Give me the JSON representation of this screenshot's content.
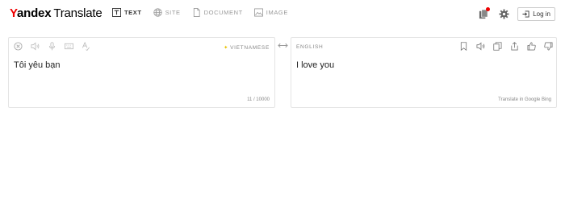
{
  "header": {
    "logo_first": "Y",
    "logo_brand": "andex",
    "logo_rest": "Translate",
    "tabs": [
      {
        "label": "TEXT",
        "active": true
      },
      {
        "label": "SITE",
        "active": false
      },
      {
        "label": "DOCUMENT",
        "active": false
      },
      {
        "label": "IMAGE",
        "active": false
      }
    ],
    "login_label": "Log in"
  },
  "source": {
    "language": "VIETNAMESE",
    "text": "Tôi yêu bạn",
    "counter": "11 / 10000"
  },
  "target": {
    "language": "ENGLISH",
    "text": "I love you",
    "powered": "Translate in Google Bing"
  },
  "colors": {
    "accent_red": "#ee0000",
    "star_yellow": "#e8c100",
    "border": "#e4e4e4"
  }
}
